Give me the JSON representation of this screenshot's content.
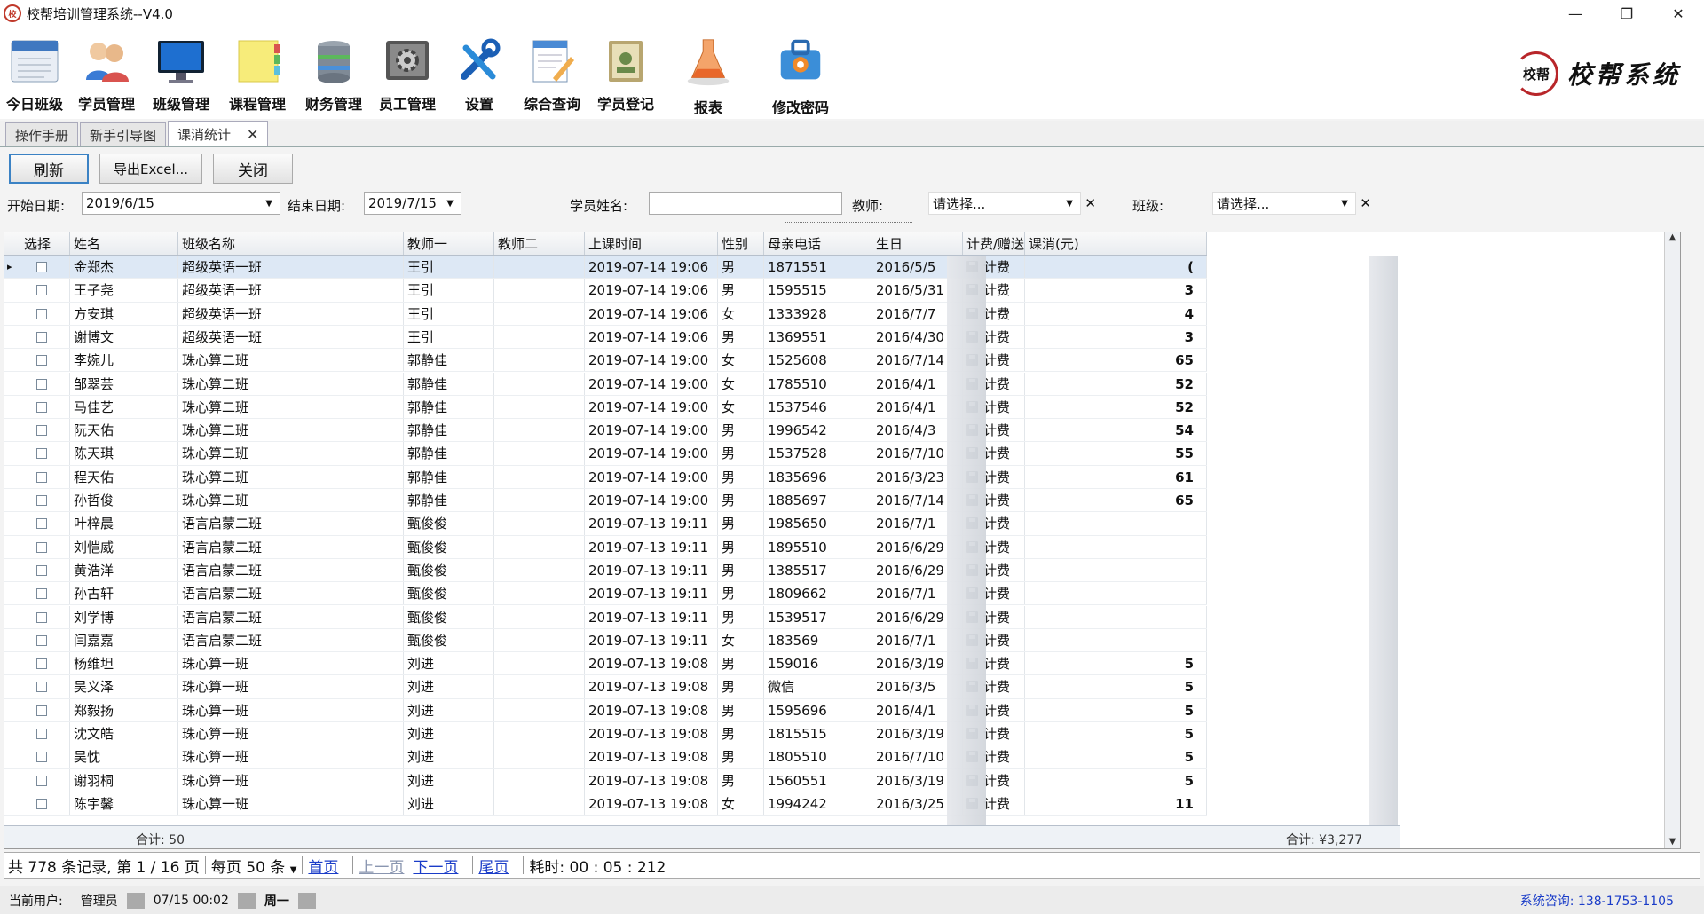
{
  "window": {
    "title": "校帮培训管理系统--V4.0",
    "controls": [
      "—",
      "❐",
      "✕"
    ]
  },
  "toolbar": {
    "items": [
      {
        "label": "今日班级",
        "icon": "calendar-board-icon"
      },
      {
        "label": "学员管理",
        "icon": "people-icon"
      },
      {
        "label": "班级管理",
        "icon": "monitor-icon"
      },
      {
        "label": "课程管理",
        "icon": "sticky-note-icon"
      },
      {
        "label": "财务管理",
        "icon": "database-icon"
      },
      {
        "label": "员工管理",
        "icon": "gear-screen-icon"
      },
      {
        "label": "设置",
        "icon": "tools-icon"
      },
      {
        "label": "综合查询",
        "icon": "edit-doc-icon"
      },
      {
        "label": "学员登记",
        "icon": "register-book-icon"
      },
      {
        "label": "报表",
        "icon": "flask-icon"
      },
      {
        "label": "修改密码",
        "icon": "lock-toolbox-icon"
      }
    ]
  },
  "brand": {
    "seal": "校帮",
    "name": "校帮系统"
  },
  "tabs": [
    {
      "label": "操作手册",
      "active": false
    },
    {
      "label": "新手引导图",
      "active": false
    },
    {
      "label": "课消统计",
      "active": true,
      "close": "✕"
    }
  ],
  "actions": {
    "refresh": "刷新",
    "export": "导出Excel...",
    "close": "关闭"
  },
  "filters": {
    "start_label": "开始日期:",
    "start_value": "2019/6/15",
    "end_label": "结束日期:",
    "end_value": "2019/7/15",
    "student_label": "学员姓名:",
    "student_value": "",
    "teacher_label": "教师:",
    "teacher_value": "请选择...",
    "class_label": "班级:",
    "class_value": "请选择..."
  },
  "grid": {
    "columns": [
      "选择",
      "姓名",
      "班级名称",
      "教师一",
      "教师二",
      "上课时间",
      "性别",
      "母亲电话",
      "生日",
      "计费/赠送",
      "课消(元)"
    ],
    "rows": [
      [
        "金郑杰",
        "超级英语一班",
        "王引",
        "",
        "2019-07-14 19:06",
        "男",
        "1871551",
        "2016/5/5",
        "计费",
        "("
      ],
      [
        "王子尧",
        "超级英语一班",
        "王引",
        "",
        "2019-07-14 19:06",
        "男",
        "1595515",
        "2016/5/31",
        "计费",
        "3"
      ],
      [
        "方安琪",
        "超级英语一班",
        "王引",
        "",
        "2019-07-14 19:06",
        "女",
        "1333928",
        "2016/7/7",
        "计费",
        "4"
      ],
      [
        "谢博文",
        "超级英语一班",
        "王引",
        "",
        "2019-07-14 19:06",
        "男",
        "1369551",
        "2016/4/30",
        "计费",
        "3"
      ],
      [
        "李婉儿",
        "珠心算二班",
        "郭静佳",
        "",
        "2019-07-14 19:00",
        "女",
        "1525608",
        "2016/7/14",
        "计费",
        "65"
      ],
      [
        "邹翠芸",
        "珠心算二班",
        "郭静佳",
        "",
        "2019-07-14 19:00",
        "女",
        "1785510",
        "2016/4/1",
        "计费",
        "52"
      ],
      [
        "马佳艺",
        "珠心算二班",
        "郭静佳",
        "",
        "2019-07-14 19:00",
        "女",
        "1537546",
        "2016/4/1",
        "计费",
        "52"
      ],
      [
        "阮天佑",
        "珠心算二班",
        "郭静佳",
        "",
        "2019-07-14 19:00",
        "男",
        "1996542",
        "2016/4/3",
        "计费",
        "54"
      ],
      [
        "陈天琪",
        "珠心算二班",
        "郭静佳",
        "",
        "2019-07-14 19:00",
        "男",
        "1537528",
        "2016/7/10",
        "计费",
        "55"
      ],
      [
        "程天佑",
        "珠心算二班",
        "郭静佳",
        "",
        "2019-07-14 19:00",
        "男",
        "1835696",
        "2016/3/23",
        "计费",
        "61"
      ],
      [
        "孙哲俊",
        "珠心算二班",
        "郭静佳",
        "",
        "2019-07-14 19:00",
        "男",
        "1885697",
        "2016/7/14",
        "计费",
        "65"
      ],
      [
        "叶梓晨",
        "语言启蒙二班",
        "甄俊俊",
        "",
        "2019-07-13 19:11",
        "男",
        "1985650",
        "2016/7/1",
        "计费",
        ""
      ],
      [
        "刘恺威",
        "语言启蒙二班",
        "甄俊俊",
        "",
        "2019-07-13 19:11",
        "男",
        "1895510",
        "2016/6/29",
        "计费",
        ""
      ],
      [
        "黄浩洋",
        "语言启蒙二班",
        "甄俊俊",
        "",
        "2019-07-13 19:11",
        "男",
        "1385517",
        "2016/6/29",
        "计费",
        ""
      ],
      [
        "孙古轩",
        "语言启蒙二班",
        "甄俊俊",
        "",
        "2019-07-13 19:11",
        "男",
        "1809662",
        "2016/7/1",
        "计费",
        ""
      ],
      [
        "刘学博",
        "语言启蒙二班",
        "甄俊俊",
        "",
        "2019-07-13 19:11",
        "男",
        "1539517",
        "2016/6/29",
        "计费",
        ""
      ],
      [
        "闫嘉嘉",
        "语言启蒙二班",
        "甄俊俊",
        "",
        "2019-07-13 19:11",
        "女",
        "183569",
        "2016/7/1",
        "计费",
        ""
      ],
      [
        "杨维坦",
        "珠心算一班",
        "刘进",
        "",
        "2019-07-13 19:08",
        "男",
        "159016",
        "2016/3/19",
        "计费",
        "5"
      ],
      [
        "吴义泽",
        "珠心算一班",
        "刘进",
        "",
        "2019-07-13 19:08",
        "男",
        "微信",
        "2016/3/5",
        "计费",
        "5"
      ],
      [
        "郑毅扬",
        "珠心算一班",
        "刘进",
        "",
        "2019-07-13 19:08",
        "男",
        "1595696",
        "2016/4/1",
        "计费",
        "5"
      ],
      [
        "沈文皓",
        "珠心算一班",
        "刘进",
        "",
        "2019-07-13 19:08",
        "男",
        "1815515",
        "2016/3/19",
        "计费",
        "5"
      ],
      [
        "吴忱",
        "珠心算一班",
        "刘进",
        "",
        "2019-07-13 19:08",
        "男",
        "1805510",
        "2016/7/10",
        "计费",
        "5"
      ],
      [
        "谢羽桐",
        "珠心算一班",
        "刘进",
        "",
        "2019-07-13 19:08",
        "男",
        "1560551",
        "2016/3/19",
        "计费",
        "5"
      ],
      [
        "陈宇馨",
        "珠心算一班",
        "刘进",
        "",
        "2019-07-13 19:08",
        "女",
        "1994242",
        "2016/3/25",
        "计费",
        "11"
      ]
    ],
    "footer_count": "合计: 50",
    "footer_sum": "合计: ¥3,277"
  },
  "pager": {
    "summary": "共 778 条记录, 第 1 / 16 页",
    "per_page": "每页 50 条",
    "first": "首页",
    "prev": "上一页",
    "next": "下一页",
    "last": "尾页",
    "elapsed": "耗时: 00 : 05 : 212"
  },
  "status": {
    "user_label": "当前用户:",
    "user": "管理员",
    "datetime": "07/15 00:02",
    "weekday": "周一",
    "consult": "系统咨询: 138-1753-1105"
  }
}
